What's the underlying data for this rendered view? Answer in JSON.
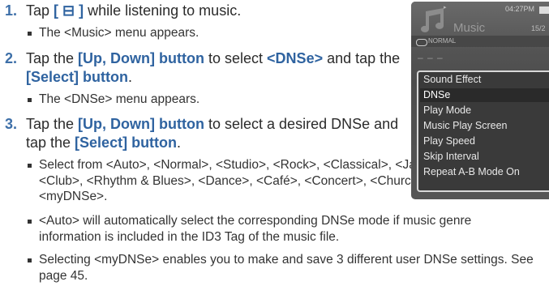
{
  "steps": [
    {
      "num": "1.",
      "parts": [
        {
          "text": "Tap ",
          "bold": false
        },
        {
          "text": "[ ⊟ ]",
          "bold": true
        },
        {
          "text": " while listening to music.",
          "bold": false
        }
      ],
      "bullets": [
        "The <Music> menu appears."
      ]
    },
    {
      "num": "2.",
      "parts": [
        {
          "text": "Tap the ",
          "bold": false
        },
        {
          "text": "[Up, Down] button",
          "bold": true
        },
        {
          "text": " to select ",
          "bold": false
        },
        {
          "text": "<DNSe>",
          "bold": true
        },
        {
          "text": " and tap the ",
          "bold": false
        },
        {
          "text": "[Select] button",
          "bold": true
        },
        {
          "text": ".",
          "bold": false
        }
      ],
      "bullets": [
        "The <DNSe> menu appears."
      ]
    },
    {
      "num": "3.",
      "parts": [
        {
          "text": "Tap the ",
          "bold": false
        },
        {
          "text": "[Up, Down] button",
          "bold": true
        },
        {
          "text": " to select a desired DNSe and tap the ",
          "bold": false
        },
        {
          "text": "[Select] button",
          "bold": true
        },
        {
          "text": ".",
          "bold": false
        }
      ],
      "bullets": [
        "Select from <Auto>, <Normal>, <Studio>, <Rock>, <Classical>, <Jazz>, <Ballad>, <Club>, <Rhythm & Blues>, <Dance>, <Café>, <Concert>, <Church> and <myDNSe>.",
        "<Auto> will automatically select the corresponding DNSe mode if music genre information is included in the ID3 Tag of the music file.",
        "Selecting <myDNSe> enables you to make and save 3 different user DNSe settings. See page 45."
      ]
    }
  ],
  "device": {
    "title": "Music",
    "play_indicator": "▸",
    "time": "04:27PM",
    "track_count": "15/2",
    "mode": "NORMAL",
    "dashes": "– –  –",
    "menu_items": [
      "Sound Effect",
      "DNSe",
      "Play Mode",
      "Music Play Screen",
      "Play Speed",
      "Skip Interval",
      "Repeat A-B Mode On"
    ],
    "active_index": 1
  }
}
